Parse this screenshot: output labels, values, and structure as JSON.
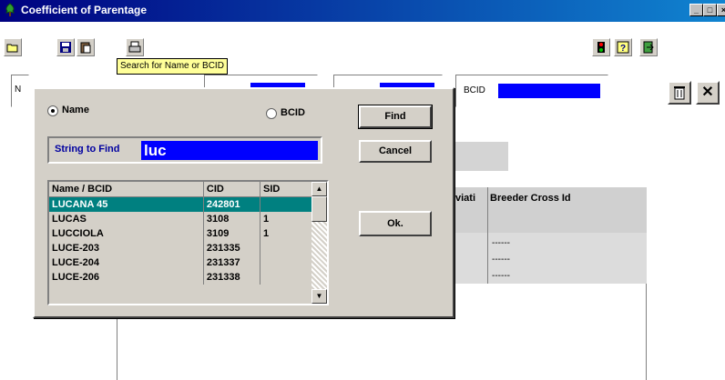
{
  "window": {
    "title": "Coefficient of Parentage"
  },
  "tooltip": "Search for Name or BCID",
  "background": {
    "field_n": "N",
    "field_bcid": "BCID",
    "headers": {
      "std_dev": "viati",
      "breeder_cross": "Breeder Cross Id"
    },
    "dash_rows": [
      "------",
      "------",
      "------"
    ]
  },
  "dialog": {
    "radio_name": {
      "label": "Name",
      "checked": true
    },
    "radio_bcid": {
      "label": "BCID",
      "checked": false
    },
    "string_label": "String to Find",
    "string_value": "luc",
    "buttons": {
      "find": "Find",
      "cancel": "Cancel",
      "ok": "Ok."
    },
    "list": {
      "columns": [
        "Name / BCID",
        "CID",
        "SID"
      ],
      "rows": [
        [
          "LUCANA 45",
          "242801",
          ""
        ],
        [
          "LUCAS",
          "3108",
          "1"
        ],
        [
          "LUCCIOLA",
          "3109",
          "1"
        ],
        [
          "LUCE-203",
          "231335",
          ""
        ],
        [
          "LUCE-204",
          "231337",
          ""
        ],
        [
          "LUCE-206",
          "231338",
          ""
        ]
      ],
      "selected_row": 0
    }
  },
  "colors": {
    "title_start": "#000080",
    "title_end": "#1084d0",
    "selection": "#008080",
    "input_bg": "#0000ff",
    "tooltip_bg": "#ffff99"
  }
}
